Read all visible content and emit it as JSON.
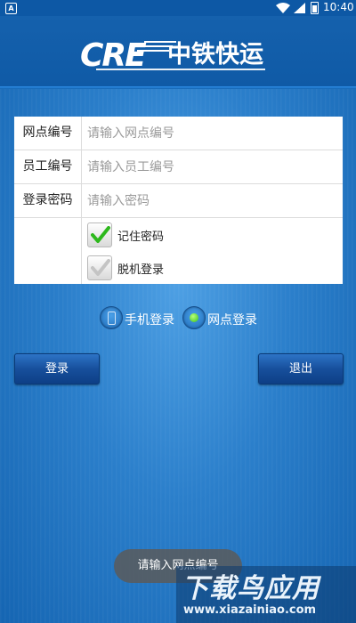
{
  "status_bar": {
    "left_icon": "A",
    "time": "10:40"
  },
  "header": {
    "logo_text": "中铁快运",
    "logo_mark": "CRE"
  },
  "form": {
    "branch": {
      "label": "网点编号",
      "placeholder": "请输入网点编号",
      "value": ""
    },
    "employee": {
      "label": "员工编号",
      "placeholder": "请输入员工编号",
      "value": ""
    },
    "password": {
      "label": "登录密码",
      "placeholder": "请输入密码",
      "value": ""
    },
    "remember": {
      "label": "记住密码",
      "checked": true
    },
    "offline": {
      "label": "脱机登录",
      "checked": false
    }
  },
  "login_mode": {
    "options": [
      {
        "label": "手机登录",
        "selected": false,
        "icon": "phone-icon"
      },
      {
        "label": "网点登录",
        "selected": true,
        "icon": "radio-dot-icon"
      }
    ]
  },
  "buttons": {
    "login": "登录",
    "exit": "退出"
  },
  "toast": {
    "text": "请输入网点编号"
  },
  "watermark": {
    "big": "下载鸟应用",
    "small": "www.xiazainiao.com"
  },
  "colors": {
    "accent": "#1565b2",
    "button": "#174f9c",
    "check": "#2db81c"
  }
}
